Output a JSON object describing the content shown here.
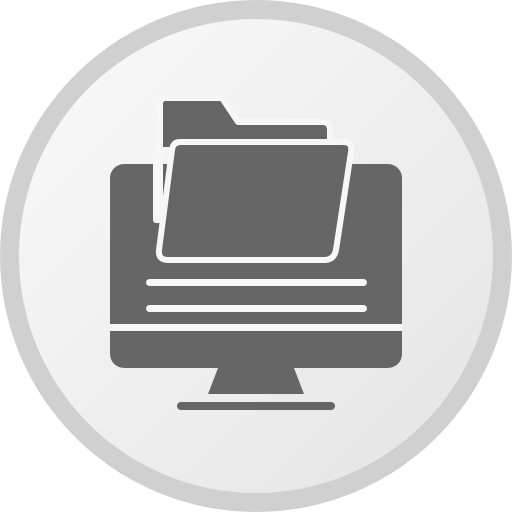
{
  "icon": {
    "name": "computer-folder-icon",
    "colors": {
      "ring": "#d0d0d0",
      "disc_light": "#fafafa",
      "disc_dark": "#e4e4e4",
      "glyph": "#666666",
      "glyph_stroke": "#f7f7f7"
    }
  }
}
